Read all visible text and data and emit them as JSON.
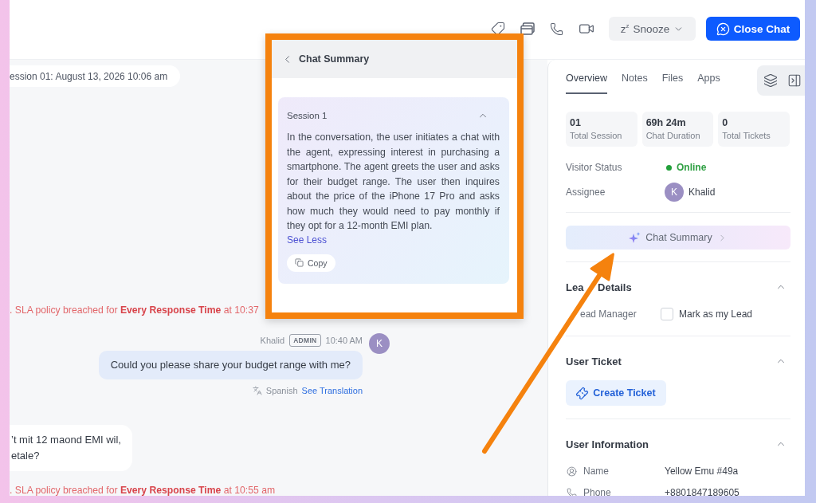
{
  "top_bar": {
    "snooze": {
      "icon_text": "z$^{z}$",
      "label": "Snooze"
    },
    "close_chat": "Close Chat"
  },
  "chat": {
    "session_label": "ession 01: August 13, 2026 10:06 am",
    "events": [
      {
        "kind": "system",
        "text": ". SLA policy breached for **Every Response Time** at 10:37"
      },
      {
        "kind": "agent",
        "sender": "Khalid",
        "role": "ADMIN",
        "time": "10:40 AM",
        "avatar": "K",
        "text": "Could you please share your budget range with me?",
        "language": "Spanish",
        "link": "See Translation"
      },
      {
        "kind": "visitor",
        "lines": [
          "’t mit 12 maond EMI wil,",
          "etale?"
        ]
      },
      {
        "kind": "system",
        "text": ". SLA policy breached for **Every Response Time** at 10:55 am"
      }
    ]
  },
  "summary": {
    "title": "Chat Summary",
    "session": "Session 1",
    "expanded": true,
    "text": "In the conversation, the user initiates a chat with the agent, expressing interest in purchasing a smartphone. The agent greets the user and asks for their budget range. The user then inquires about the price of the iPhone 17 Pro and asks how much they would need to pay monthly if they opt for a 12-month EMI plan.",
    "toggle": "See Less",
    "copy": "Copy"
  },
  "right_panel": {
    "tabs": [
      {
        "label": "Overview",
        "selected": true
      },
      {
        "label": "Notes",
        "selected": false
      },
      {
        "label": "Files",
        "selected": false
      },
      {
        "label": "Apps",
        "selected": false
      }
    ],
    "stats": [
      {
        "value": "01",
        "label": "Total Session"
      },
      {
        "value": "69h 24m",
        "label": "Chat Duration"
      },
      {
        "value": "0",
        "label": "Total Tickets"
      }
    ],
    "visitor_status": {
      "label": "Visitor Status",
      "value": "Online",
      "online": true
    },
    "assignee": {
      "label": "Assignee",
      "avatar": "K",
      "name": "Khalid"
    },
    "summary_button": "Chat Summary",
    "sections": [
      {
        "kind": "lead",
        "title": "Lea Details",
        "expanded": true,
        "field": "ead Manager",
        "checkbox": {
          "label": "Mark as my Lead",
          "checked": false
        }
      },
      {
        "kind": "ticket",
        "title": "User Ticket",
        "expanded": true,
        "button": "Create Ticket"
      },
      {
        "kind": "info",
        "title": "User Information",
        "expanded": true,
        "rows": [
          {
            "kind": "user",
            "label": "Name",
            "value": "Yellow Emu #49a"
          },
          {
            "kind": "phone",
            "label": "Phone",
            "value": "+8801847189605"
          }
        ]
      }
    ]
  }
}
